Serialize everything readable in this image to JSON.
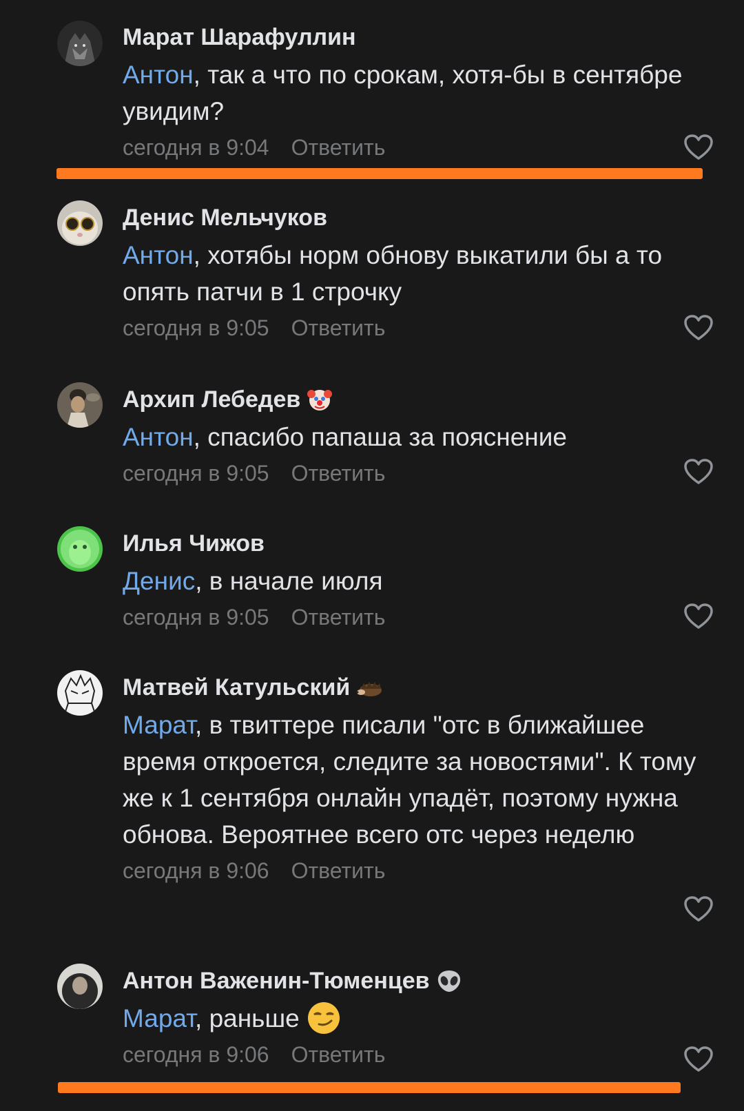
{
  "comments": [
    {
      "author": "Марат Шарафуллин",
      "mention": "Антон",
      "text": ", так а что по срокам, хотя-бы в сентябре увидим?",
      "time": "сегодня в 9:04",
      "reply": "Ответить"
    },
    {
      "author": "Денис Мельчуков",
      "mention": "Антон",
      "text": ", хотябы норм обнову выкатили бы а то опять патчи в 1 строчку",
      "time": "сегодня в 9:05",
      "reply": "Ответить"
    },
    {
      "author": "Архип Лебедев",
      "badge": "clown-emoji",
      "mention": "Антон",
      "text": ", спасибо папаша за пояснение",
      "time": "сегодня в 9:05",
      "reply": "Ответить"
    },
    {
      "author": "Илья Чижов",
      "mention": "Денис",
      "text": ", в начале июля",
      "time": "сегодня в 9:05",
      "reply": "Ответить"
    },
    {
      "author": "Матвей Катульский",
      "badge": "hedgehog-emoji",
      "mention": "Марат",
      "text": ", в твиттере писали \"отс в ближайшее время откроется, следите за новостями\". К тому же к 1 сентября онлайн упадёт, поэтому нужна обнова. Вероятнее всего отс через неделю",
      "time": "сегодня в 9:06",
      "reply": "Ответить"
    },
    {
      "author": "Антон Важенин-Тюменцев",
      "badge": "alien-emoji",
      "mention": "Марат",
      "text": ", раньше",
      "text_emoji": "smirk-emoji",
      "time": "сегодня в 9:06",
      "reply": "Ответить"
    }
  ],
  "colors": {
    "background": "#19191a",
    "text": "#e1e3e6",
    "mention": "#71aaeb",
    "meta": "#76787a",
    "highlight": "#ff7a1f"
  }
}
